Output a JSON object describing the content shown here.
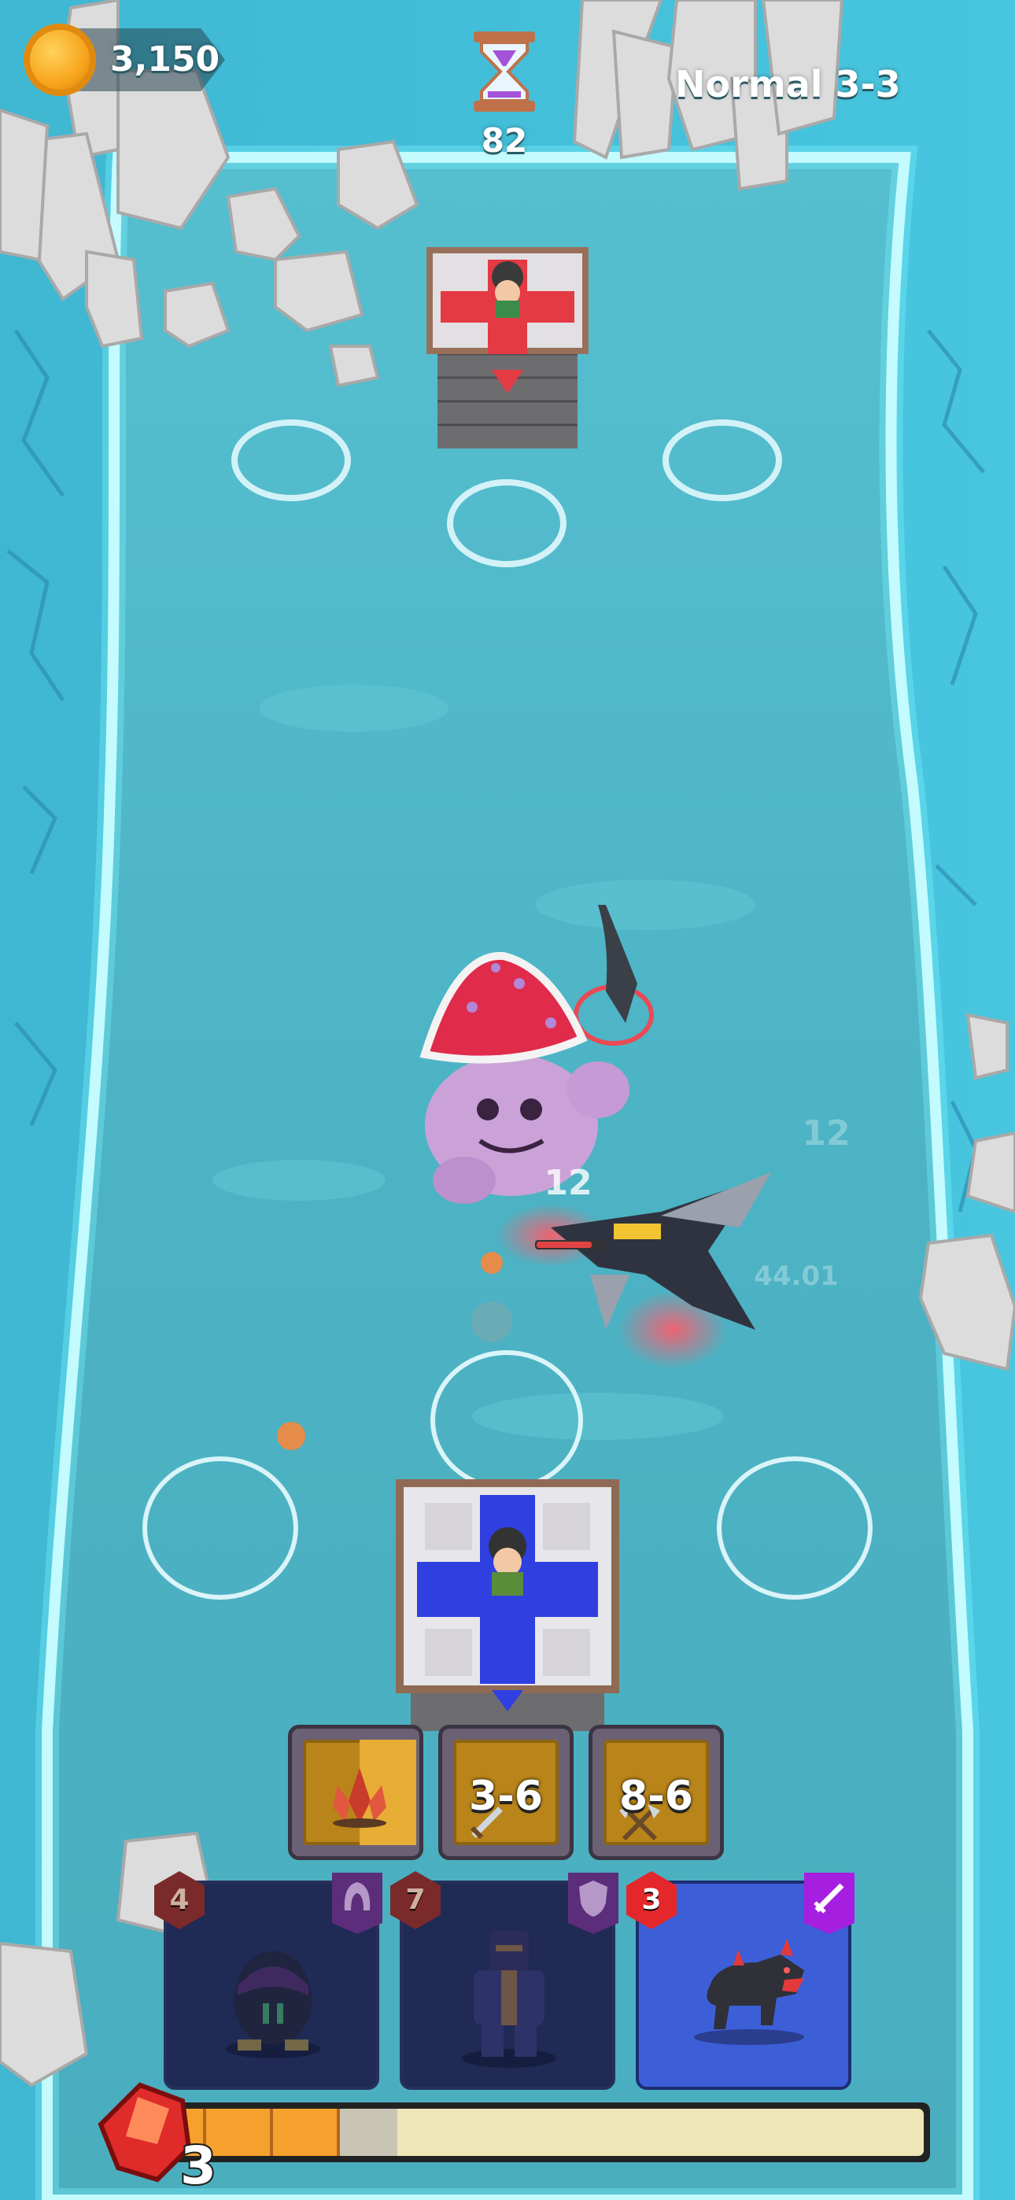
{
  "hud": {
    "coins": "3,150",
    "timer": "82",
    "level": "Normal 3-3"
  },
  "floating_numbers": [
    "12",
    "12",
    "44.01"
  ],
  "merge_slots": [
    {
      "label": "",
      "icon": "crystal-shard-icon"
    },
    {
      "label": "3-6",
      "icon": "sword-icon"
    },
    {
      "label": "8-6",
      "icon": "crossed-axes-icon"
    }
  ],
  "unit_cards": [
    {
      "cost": "4",
      "type_icon": "hood-icon",
      "unit": "dark-goblin",
      "available": false
    },
    {
      "cost": "7",
      "type_icon": "shield-icon",
      "unit": "armored-knight",
      "available": false
    },
    {
      "cost": "3",
      "type_icon": "sword-icon",
      "unit": "black-wolf",
      "available": true
    }
  ],
  "mana": {
    "value": "3",
    "fill_fraction": 0.28
  }
}
